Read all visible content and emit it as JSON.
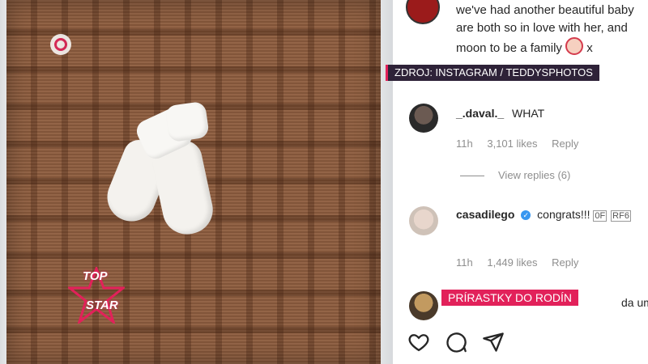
{
  "caption": {
    "lines": [
      "we've had another beautiful baby",
      "are both so in love with her, and",
      "moon to be a family",
      "x"
    ]
  },
  "comments": [
    {
      "username": "_.daval._",
      "text": "WHAT",
      "time": "11h",
      "likes": "3,101 likes",
      "reply": "Reply",
      "view_replies": "View replies (6)"
    },
    {
      "username": "casadilego",
      "text": "congrats!!!",
      "emoji_codes": [
        "0F",
        "RF6"
      ],
      "time": "11h",
      "likes": "1,449 likes",
      "reply": "Reply"
    },
    {
      "username": "",
      "text_fragment": "da um filh"
    }
  ],
  "overlays": {
    "source": "ZDROJ: INSTAGRAM / TEDDYSPHOTOS",
    "section": "PRÍRASTKY DO RODÍN",
    "brand_line1": "TOP",
    "brand_line2": "STAR"
  },
  "icons": [
    "heart-icon",
    "comment-icon",
    "share-icon"
  ],
  "colors": {
    "accent": "#e2215a",
    "tag_bg": "#2e2238",
    "verified": "#3897f0",
    "meta_text": "#8e8e8e"
  }
}
